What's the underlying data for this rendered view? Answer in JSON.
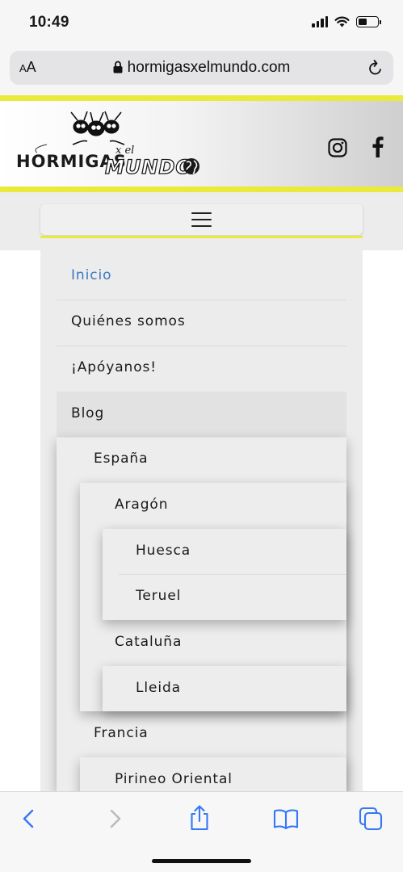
{
  "status_bar": {
    "time": "10:49",
    "signal_icon": "cellular-signal-icon",
    "wifi_icon": "wifi-icon",
    "battery_icon": "battery-icon",
    "battery_level": 0.45
  },
  "browser": {
    "aa_label_small": "A",
    "aa_label_large": "A",
    "url": "hormigasxelmundo.com",
    "lock_icon": "lock-icon",
    "reload_icon": "reload-icon"
  },
  "site": {
    "logo": {
      "text_line1": "HORMIGAS",
      "text_xel": "x el",
      "text_line2": "MUNDO"
    },
    "social": [
      "instagram-icon",
      "facebook-icon"
    ],
    "accent_color": "#eaea3c",
    "link_color": "#3a78c3"
  },
  "menu": {
    "toggle_icon": "hamburger-menu-icon",
    "items": [
      {
        "label": "Inicio",
        "active": true
      },
      {
        "label": "Quiénes somos"
      },
      {
        "label": "¡Apóyanos!"
      },
      {
        "label": "Blog"
      },
      {
        "label": "España"
      },
      {
        "label": "Aragón"
      },
      {
        "label": "Huesca"
      },
      {
        "label": "Teruel"
      },
      {
        "label": "Cataluña"
      },
      {
        "label": "Lleida"
      },
      {
        "label": "Francia"
      },
      {
        "label": "Pirineo Oriental"
      }
    ]
  },
  "toolbar": {
    "icons": [
      "back-icon",
      "forward-icon",
      "share-icon",
      "bookmarks-icon",
      "tabs-icon"
    ],
    "icon_color": "#3478f6"
  }
}
